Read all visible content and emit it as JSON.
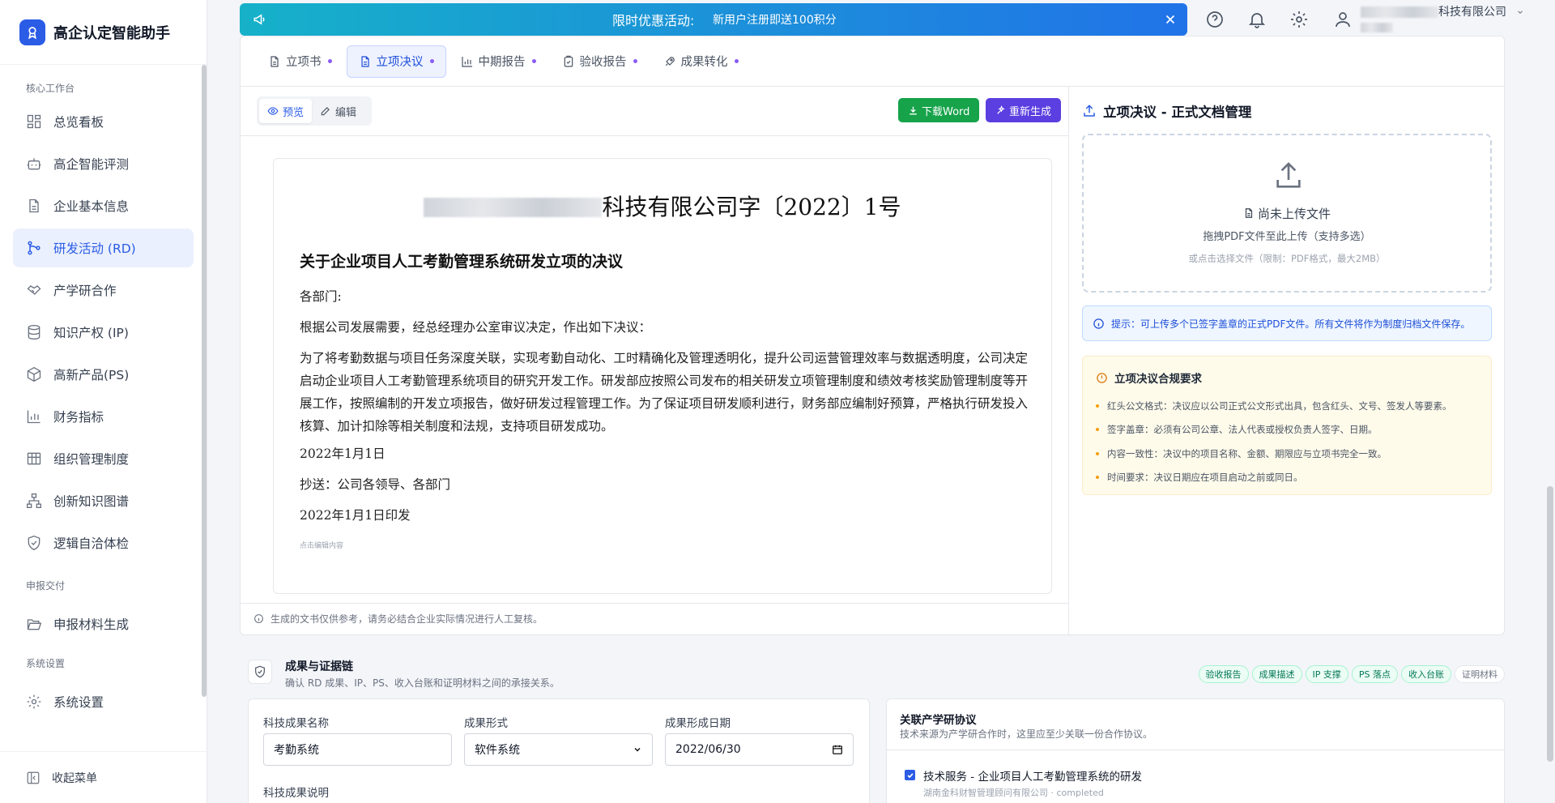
{
  "app": {
    "title": "高企认定智能助手"
  },
  "sidebar": {
    "section_core": "核心工作台",
    "items_core": [
      {
        "label": "总览看板"
      },
      {
        "label": "高企智能评测"
      },
      {
        "label": "企业基本信息"
      },
      {
        "label": "研发活动 (RD)",
        "active": true
      },
      {
        "label": "产学研合作"
      },
      {
        "label": "知识产权 (IP)"
      },
      {
        "label": "高新产品(PS)"
      },
      {
        "label": "财务指标"
      },
      {
        "label": "组织管理制度"
      },
      {
        "label": "创新知识图谱"
      },
      {
        "label": "逻辑自洽体检"
      }
    ],
    "section_delivery": "申报交付",
    "items_delivery": [
      {
        "label": "申报材料生成"
      }
    ],
    "section_settings": "系统设置",
    "items_settings": [
      {
        "label": "系统设置"
      }
    ],
    "collapse_label": "收起菜单"
  },
  "banner": {
    "title": "限时优惠活动:",
    "text": "新用户注册即送100积分"
  },
  "header": {
    "user_company": "科技有限公司"
  },
  "tabs": [
    {
      "label": "立项书",
      "icon": "doc-icon"
    },
    {
      "label": "立项决议",
      "icon": "doc-icon",
      "active": true
    },
    {
      "label": "中期报告",
      "icon": "chart-icon"
    },
    {
      "label": "验收报告",
      "icon": "clipboard-icon"
    },
    {
      "label": "成果转化",
      "icon": "rocket-icon"
    }
  ],
  "editor": {
    "preview_label": "预览",
    "edit_label": "编辑",
    "download_label": "下载Word",
    "regenerate_label": "重新生成"
  },
  "document": {
    "header_suffix": "科技有限公司字〔2022〕1号",
    "title": "关于企业项目人工考勤管理系统研发立项的决议",
    "salutation": "各部门:",
    "intro": "根据公司发展需要，经总经理办公室审议决定，作出如下决议：",
    "body": "为了将考勤数据与项目任务深度关联，实现考勤自动化、工时精确化及管理透明化，提升公司运营管理效率与数据透明度，公司决定启动企业项目人工考勤管理系统项目的研究开发工作。研发部应按照公司发布的相关研发立项管理制度和绩效考核奖励管理制度等开展工作，按照编制的开发立项报告，做好研发过程管理工作。为了保证项目研发顺利进行，财务部应编制好预算，严格执行研发投入核算、加计扣除等相关制度和法规，支持项目研发成功。",
    "date": "2022年1月1日",
    "cc": "抄送：公司各领导、各部门",
    "printed": "2022年1月1日印发",
    "edit_hint": "点击编辑内容"
  },
  "footer_note": "生成的文书仅供参考，请务必结合企业实际情况进行人工复核。",
  "right_panel": {
    "title": "立项决议 - 正式文档管理",
    "upload_status": "尚未上传文件",
    "upload_drag": "拖拽PDF文件至此上传（支持多选）",
    "upload_click": "或点击选择文件（限制：PDF格式，最大2MB）",
    "tip": "提示：可上传多个已签字盖章的正式PDF文件。所有文件将作为制度归档文件保存。",
    "requirements_title": "立项决议合规要求",
    "requirements": [
      "红头公文格式：决议应以公司正式公文形式出具，包含红头、文号、签发人等要素。",
      "签字盖章：必须有公司公章、法人代表或授权负责人签字、日期。",
      "内容一致性：决议中的项目名称、金额、期限应与立项书完全一致。",
      "时间要求：决议日期应在项目启动之前或同日。"
    ]
  },
  "evidence": {
    "title": "成果与证据链",
    "subtitle": "确认 RD 成果、IP、PS、收入台账和证明材料之间的承接关系。",
    "chips": [
      "验收报告",
      "成果描述",
      "IP 支撑",
      "PS 落点",
      "收入台账",
      "证明材料"
    ]
  },
  "form": {
    "name_label": "科技成果名称",
    "name_value": "考勤系统",
    "form_label": "成果形式",
    "form_value": "软件系统",
    "date_label": "成果形成日期",
    "date_value": "2022/06/30",
    "desc_label": "科技成果说明"
  },
  "ip": {
    "title": "关联产学研协议",
    "subtitle": "技术来源为产学研合作时，这里应至少关联一份合作协议。",
    "item_main": "技术服务 - 企业项目人工考勤管理系统的研发",
    "item_meta": "湖南金科财智管理顾问有限公司 · completed"
  },
  "colors": {
    "primary": "#2b5ce6",
    "green": "#16a34a",
    "purple": "#5b3fe0"
  }
}
